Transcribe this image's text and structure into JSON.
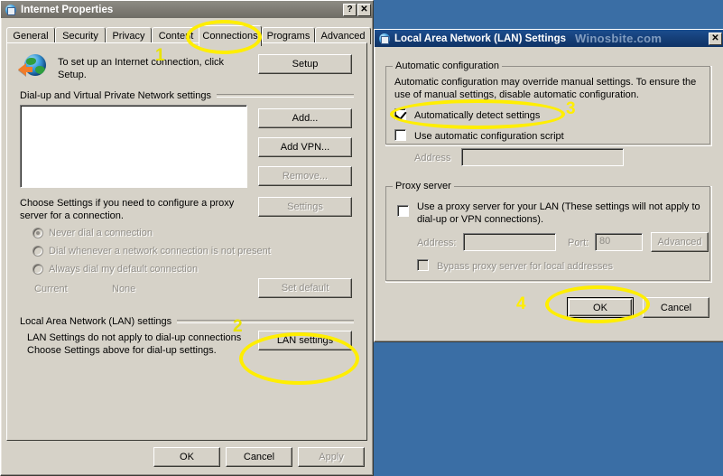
{
  "desktop": {
    "background_color": "#3a6ea5"
  },
  "internet_properties": {
    "title": "Internet Properties",
    "icon": "globe-document-icon",
    "titlebar_buttons": {
      "help": "?",
      "close": "✕"
    },
    "tabs": [
      {
        "label": "General",
        "active": false
      },
      {
        "label": "Security",
        "active": false
      },
      {
        "label": "Privacy",
        "active": false
      },
      {
        "label": "Content",
        "active": false
      },
      {
        "label": "Connections",
        "active": true
      },
      {
        "label": "Programs",
        "active": false
      },
      {
        "label": "Advanced",
        "active": false
      }
    ],
    "setup": {
      "icon": "globe-with-arrow-icon",
      "text": "To set up an Internet connection, click Setup.",
      "button": "Setup"
    },
    "dialup_group_label": "Dial-up and Virtual Private Network settings",
    "dialup_list_items": [],
    "dialup_buttons": [
      {
        "label": "Add...",
        "disabled": false
      },
      {
        "label": "Add VPN...",
        "disabled": false
      },
      {
        "label": "Remove...",
        "disabled": true
      }
    ],
    "proxy_hint": "Choose Settings if you need to configure a proxy server for a connection.",
    "settings_button": {
      "label": "Settings",
      "disabled": true
    },
    "dial_options": [
      {
        "label": "Never dial a connection",
        "selected": true,
        "disabled": true
      },
      {
        "label": "Dial whenever a network connection is not present",
        "selected": false,
        "disabled": true
      },
      {
        "label": "Always dial my default connection",
        "selected": false,
        "disabled": true
      }
    ],
    "current_label": "Current",
    "current_value": "None",
    "set_default_button": {
      "label": "Set default",
      "disabled": true
    },
    "lan_group_label": "Local Area Network (LAN) settings",
    "lan_hint_line1": "LAN Settings do not apply to dial-up connections",
    "lan_hint_line2": "Choose Settings above for dial-up settings.",
    "lan_settings_button": {
      "label": "LAN settings",
      "disabled": false
    },
    "footer_buttons": [
      {
        "label": "OK",
        "disabled": false
      },
      {
        "label": "Cancel",
        "disabled": false
      },
      {
        "label": "Apply",
        "disabled": true
      }
    ]
  },
  "lan_settings": {
    "title": "Local Area Network (LAN) Settings",
    "icon": "globe-document-icon",
    "watermark": "Winosbite.com",
    "close_button": "✕",
    "automatic_configuration": {
      "group_label": "Automatic configuration",
      "description_line1": "Automatic configuration may override manual settings.  To ensure the",
      "description_line2": "use of manual settings, disable automatic configuration.",
      "auto_detect": {
        "label": "Automatically detect settings",
        "checked": true,
        "disabled": false
      },
      "use_script": {
        "label": "Use automatic configuration script",
        "checked": false,
        "disabled": false
      },
      "address_label": "Address",
      "address_value": "",
      "address_disabled": true
    },
    "proxy_server": {
      "group_label": "Proxy server",
      "use_proxy": {
        "label_line1": "Use a proxy server for your LAN (These settings will not apply to",
        "label_line2": "dial-up or VPN connections).",
        "checked": false,
        "disabled": false
      },
      "address_label": "Address:",
      "address_value": "",
      "port_label": "Port:",
      "port_value": "80",
      "advanced_button": {
        "label": "Advanced",
        "disabled": true
      },
      "bypass": {
        "label": "Bypass proxy server for local addresses",
        "checked": false,
        "disabled": true
      }
    },
    "footer_buttons": [
      {
        "label": "OK",
        "disabled": false,
        "default": true
      },
      {
        "label": "Cancel",
        "disabled": false,
        "default": false
      }
    ]
  },
  "annotations": {
    "accent_color": "#ffee00",
    "steps": [
      {
        "number": "1",
        "target": "Connections tab"
      },
      {
        "number": "2",
        "target": "LAN settings button"
      },
      {
        "number": "3",
        "target": "Automatically detect settings checkbox"
      },
      {
        "number": "4",
        "target": "OK button of LAN Settings dialog"
      }
    ]
  }
}
